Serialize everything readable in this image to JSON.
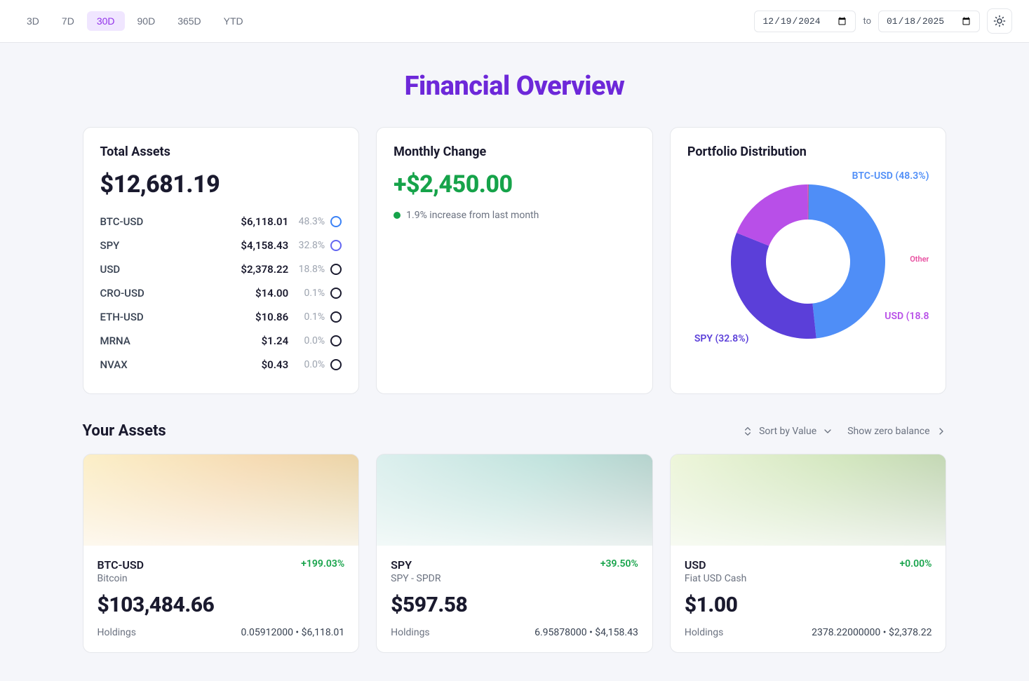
{
  "topbar": {
    "ranges": [
      "3D",
      "7D",
      "30D",
      "90D",
      "365D",
      "YTD"
    ],
    "active_range": "30D",
    "date_from": "2024-12-19",
    "date_to": "2025-01-18",
    "to_label": "to"
  },
  "page_title": "Financial Overview",
  "total_assets": {
    "title": "Total Assets",
    "value": "$12,681.19",
    "rows": [
      {
        "name": "BTC-USD",
        "value": "$6,118.01",
        "pct": "48.3%",
        "ring": "b1"
      },
      {
        "name": "SPY",
        "value": "$4,158.43",
        "pct": "32.8%",
        "ring": "b2"
      },
      {
        "name": "USD",
        "value": "$2,378.22",
        "pct": "18.8%",
        "ring": ""
      },
      {
        "name": "CRO-USD",
        "value": "$14.00",
        "pct": "0.1%",
        "ring": ""
      },
      {
        "name": "ETH-USD",
        "value": "$10.86",
        "pct": "0.1%",
        "ring": ""
      },
      {
        "name": "MRNA",
        "value": "$1.24",
        "pct": "0.0%",
        "ring": ""
      },
      {
        "name": "NVAX",
        "value": "$0.43",
        "pct": "0.0%",
        "ring": ""
      }
    ]
  },
  "monthly_change": {
    "title": "Monthly Change",
    "value": "+$2,450.00",
    "note": "1.9% increase from last month"
  },
  "distribution": {
    "title": "Portfolio Distribution",
    "labels": {
      "btc": "BTC-USD (48.3%)",
      "spy": "SPY (32.8%)",
      "usd": "USD (18.8",
      "other": "Other"
    }
  },
  "chart_data": {
    "type": "pie",
    "title": "Portfolio Distribution",
    "series": [
      {
        "name": "BTC-USD",
        "value": 48.3,
        "color": "#4f8ef7"
      },
      {
        "name": "SPY",
        "value": 32.8,
        "color": "#5b3fd9"
      },
      {
        "name": "USD",
        "value": 18.8,
        "color": "#b84fe8"
      },
      {
        "name": "CRO-USD",
        "value": 0.1,
        "color": "#e84fa0"
      },
      {
        "name": "ETH-USD",
        "value": 0.1,
        "color": "#e84f6f"
      },
      {
        "name": "MRNA",
        "value": 0.0,
        "color": "#e8774f"
      },
      {
        "name": "NVAX",
        "value": 0.0,
        "color": "#e8a44f"
      }
    ]
  },
  "assets_section": {
    "title": "Your Assets",
    "sort_label": "Sort by Value",
    "zero_label": "Show zero balance"
  },
  "asset_cards": [
    {
      "sym": "BTC-USD",
      "sub": "Bitcoin",
      "chg": "+199.03%",
      "price": "$103,484.66",
      "hold_label": "Holdings",
      "hold": "0.05912000 • $6,118.01",
      "hero": "hero-btc"
    },
    {
      "sym": "SPY",
      "sub": "SPY - SPDR",
      "chg": "+39.50%",
      "price": "$597.58",
      "hold_label": "Holdings",
      "hold": "6.95878000 • $4,158.43",
      "hero": "hero-spy"
    },
    {
      "sym": "USD",
      "sub": "Fiat USD Cash",
      "chg": "+0.00%",
      "price": "$1.00",
      "hold_label": "Holdings",
      "hold": "2378.22000000 • $2,378.22",
      "hero": "hero-usd"
    }
  ]
}
